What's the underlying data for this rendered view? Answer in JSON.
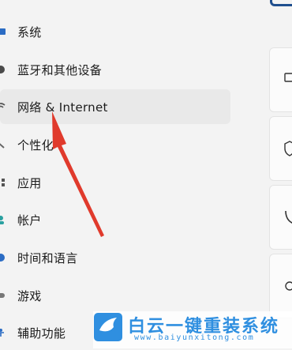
{
  "sidebar": {
    "items": [
      {
        "label": "系统",
        "icon": "monitor-icon",
        "selected": false
      },
      {
        "label": "蓝牙和其他设备",
        "icon": "bluetooth-icon",
        "selected": false
      },
      {
        "label": "网络 & Internet",
        "icon": "network-icon",
        "selected": true
      },
      {
        "label": "个性化",
        "icon": "brush-icon",
        "selected": false
      },
      {
        "label": "应用",
        "icon": "apps-icon",
        "selected": false
      },
      {
        "label": "帐户",
        "icon": "account-icon",
        "selected": false
      },
      {
        "label": "时间和语言",
        "icon": "globe-clock-icon",
        "selected": false
      },
      {
        "label": "游戏",
        "icon": "gamepad-icon",
        "selected": false
      },
      {
        "label": "辅助功能",
        "icon": "accessibility-icon",
        "selected": false
      }
    ]
  },
  "watermark": {
    "title": "白云一键重装系统",
    "url": "www.baiyunxitong.com"
  },
  "colors": {
    "accent": "#0067c0",
    "arrow": "#e03a2c",
    "watermark": "#2f8fe0",
    "selected_bg": "#e9e9e9"
  }
}
